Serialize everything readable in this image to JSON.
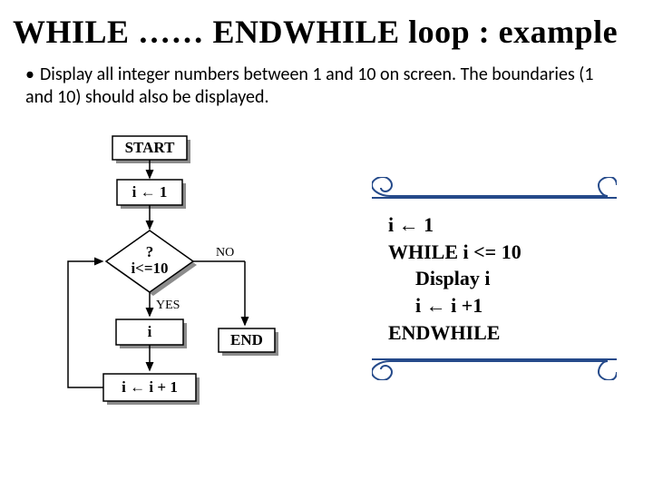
{
  "title": "WHILE …… ENDWHILE  loop : example",
  "bullet": "Display all integer numbers between 1 and 10 on screen. The boundaries (1 and 10) should also be displayed.",
  "flow": {
    "start": "START",
    "init": "i ← 1",
    "cond_q": "?",
    "cond": "i<=10",
    "yes": "YES",
    "no": "NO",
    "display": "i",
    "inc": "i ← i + 1",
    "end": "END"
  },
  "pseudo": {
    "l1": "i ← 1",
    "l2": "WHILE i <= 10",
    "l3": "Display  i",
    "l4": "i ← i +1",
    "l5": "ENDWHILE"
  }
}
